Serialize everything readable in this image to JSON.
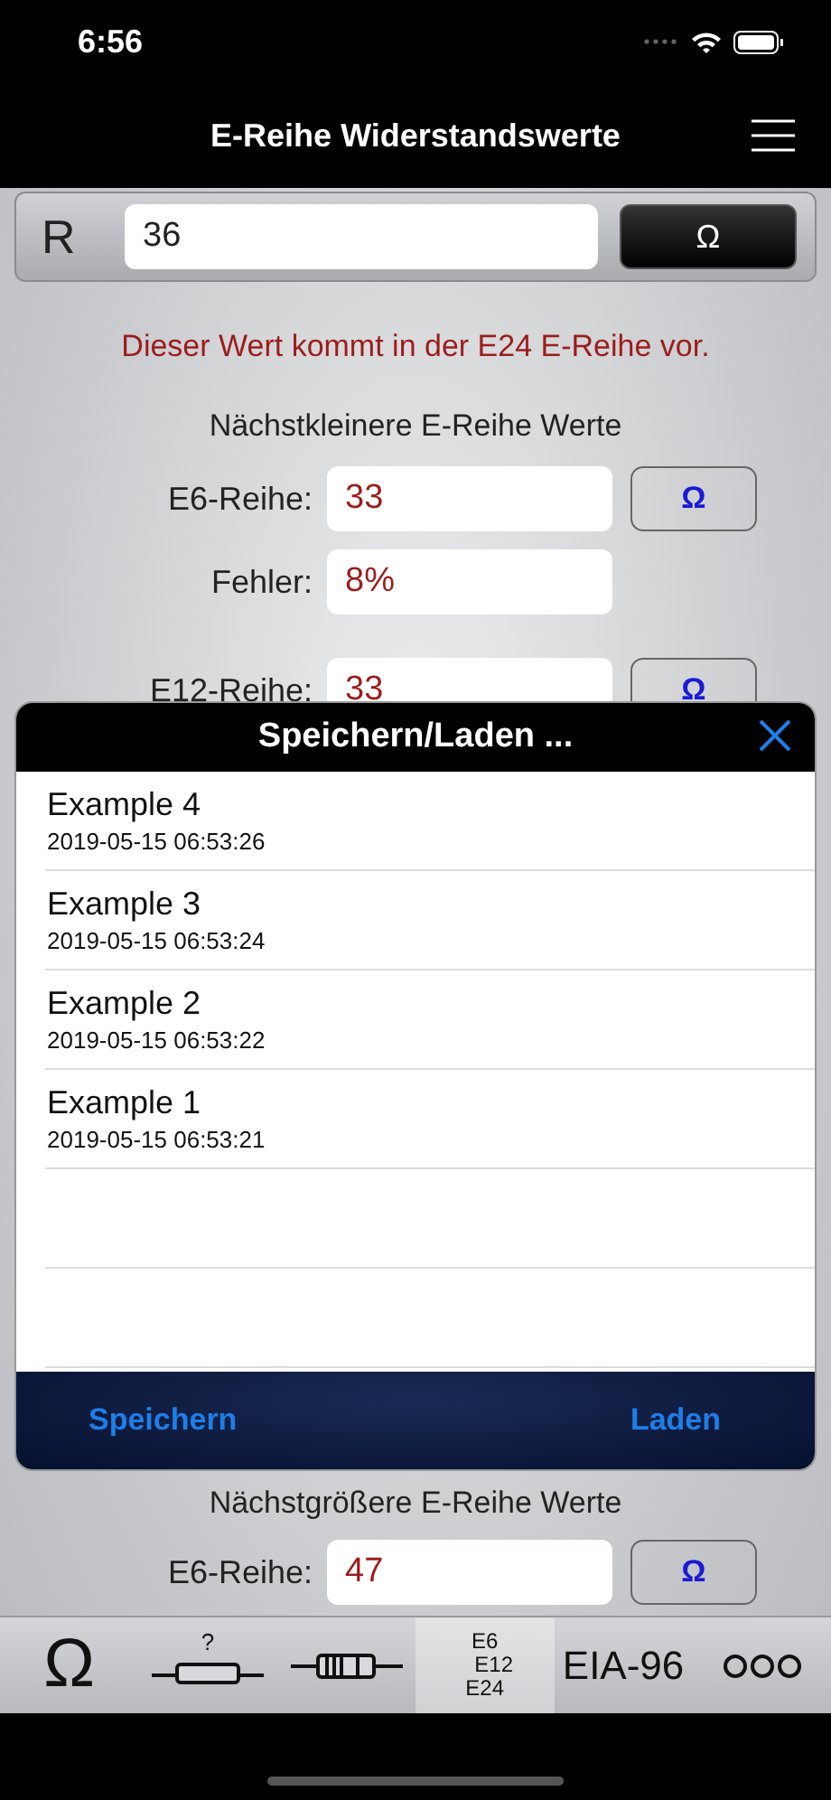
{
  "status_bar": {
    "time": "6:56"
  },
  "nav": {
    "title": "E-Reihe Widerstandswerte"
  },
  "input": {
    "label": "R",
    "value": "36",
    "unit_button": "Ω"
  },
  "message": "Dieser Wert kommt in der E24 E-Reihe vor.",
  "smaller": {
    "heading": "Nächstkleinere E-Reihe Werte",
    "rows": [
      {
        "label": "E6-Reihe:",
        "value": "33",
        "button": "Ω"
      },
      {
        "label": "Fehler:",
        "value": "8%"
      },
      {
        "label": "E12-Reihe:",
        "value": "33",
        "button": "Ω"
      }
    ]
  },
  "larger": {
    "heading": "Nächstgrößere E-Reihe Werte",
    "rows": [
      {
        "label": "E6-Reihe:",
        "value": "47",
        "button": "Ω"
      }
    ]
  },
  "dialog": {
    "title": "Speichern/Laden ...",
    "items": [
      {
        "name": "Example 4",
        "date": "2019-05-15 06:53:26"
      },
      {
        "name": "Example 3",
        "date": "2019-05-15 06:53:24"
      },
      {
        "name": "Example 2",
        "date": "2019-05-15 06:53:22"
      },
      {
        "name": "Example 1",
        "date": "2019-05-15 06:53:21"
      }
    ],
    "buttons": [
      "Speichern",
      "Laden"
    ]
  },
  "tabs": [
    {
      "kind": "glyph",
      "label": "Ω",
      "selected": false
    },
    {
      "kind": "resistor_question",
      "label": "?",
      "selected": false
    },
    {
      "kind": "resistor_bands",
      "selected": false
    },
    {
      "kind": "stack",
      "lines": [
        "E6",
        "E12",
        "E24"
      ],
      "selected": true
    },
    {
      "kind": "text",
      "label": "EIA-96",
      "selected": false
    },
    {
      "kind": "more",
      "selected": false
    }
  ]
}
